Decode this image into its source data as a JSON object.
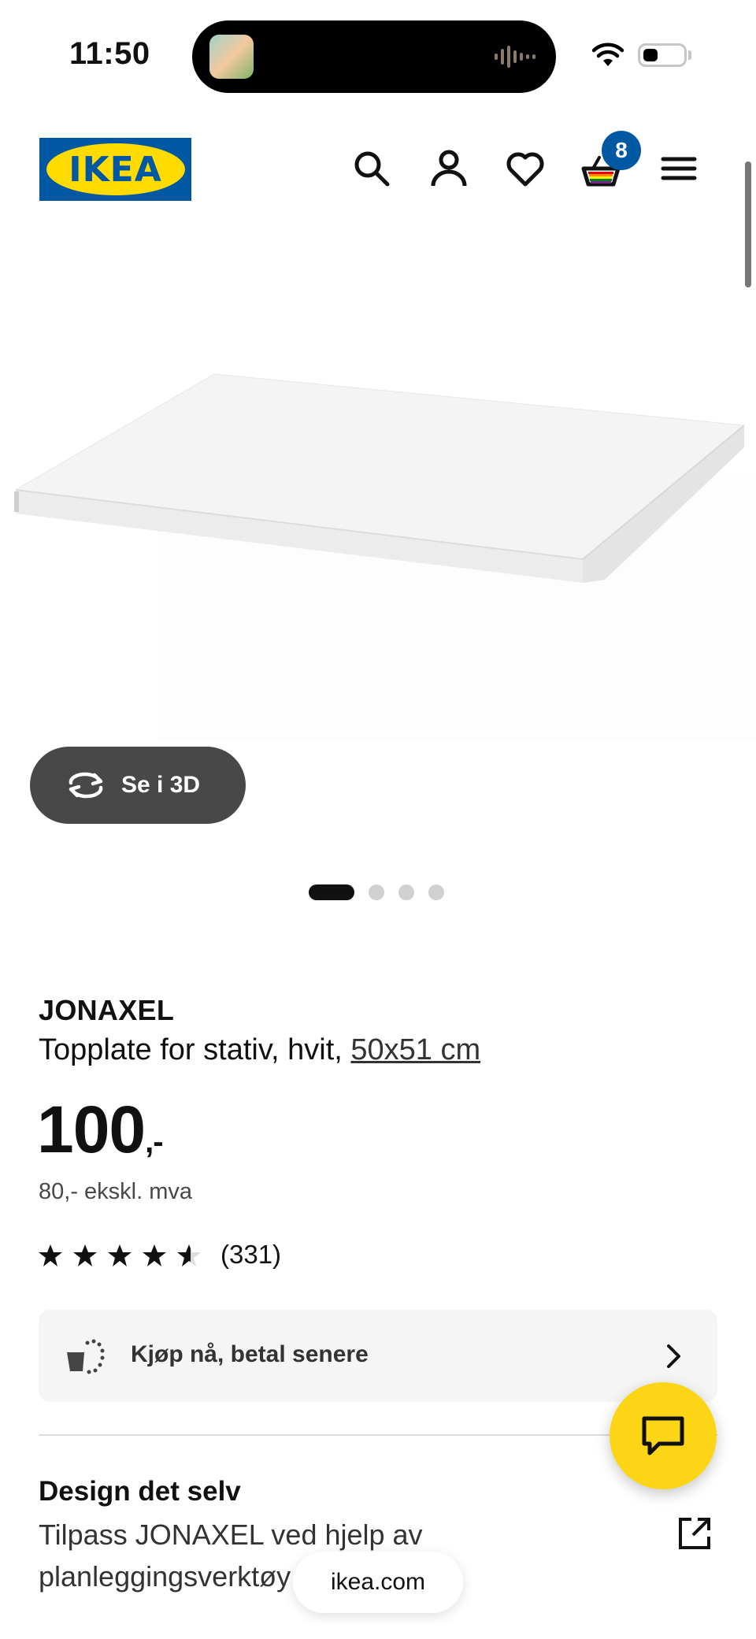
{
  "status_bar": {
    "time": "11:50"
  },
  "header": {
    "logo_text": "IKEA",
    "cart_count": "8",
    "icons": [
      "search-icon",
      "account-icon",
      "heart-icon",
      "cart-icon",
      "menu-icon"
    ]
  },
  "gallery": {
    "view_3d_label": "Se i 3D",
    "pages": 4,
    "active_page": 1
  },
  "product": {
    "name": "JONAXEL",
    "description": "Topplate for stativ, hvit, ",
    "size": "50x51 cm",
    "price": "100",
    "price_suffix": ",-",
    "price_ex_vat": "80,- ekskl. mva",
    "rating": 4.5,
    "rating_count": "(331)"
  },
  "bnpl": {
    "label": "Kjøp nå, betal senere"
  },
  "design": {
    "title": "Design det selv",
    "text": "Tilpass JONAXEL ved hjelp av planleggingsverktøy"
  },
  "browser": {
    "url": "ikea.com"
  },
  "colors": {
    "ikea_blue": "#0058a3",
    "ikea_yellow": "#ffdb00",
    "chat_yellow": "#fcd616",
    "dark_button": "#484848"
  }
}
